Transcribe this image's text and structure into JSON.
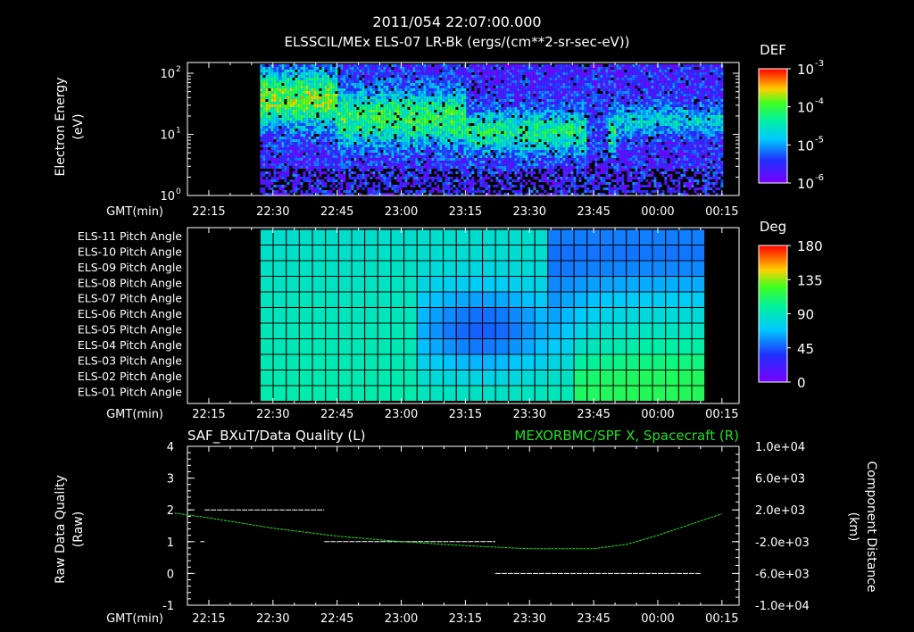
{
  "header": {
    "timestamp": "2011/054 22:07:00.000",
    "subtitle": "ELSSCIL/MEx ELS-07 LR-Bk  (ergs/(cm**2-sr-sec-eV))"
  },
  "time_axis": {
    "label": "GMT(min)",
    "ticks": [
      "22:15",
      "22:30",
      "22:45",
      "23:00",
      "23:15",
      "23:30",
      "23:45",
      "00:00",
      "00:15"
    ],
    "start_minutes": 1330,
    "end_minutes": 1459
  },
  "colors": {
    "background": "#000000",
    "foreground": "#ffffff",
    "series_green": "#22dd22",
    "colorbar_top": "#ff0000",
    "colorbar_bottom": "#6600ff"
  },
  "chart_data": [
    {
      "type": "heatmap",
      "ylabel": "Electron Energy\n(eV)",
      "ylabel_lines": [
        "Electron Energy",
        "(eV)"
      ],
      "yscale": "log",
      "ylim": [
        1,
        150
      ],
      "yticks": [
        {
          "base": "10",
          "exp": "0"
        },
        {
          "base": "10",
          "exp": "1"
        },
        {
          "base": "10",
          "exp": "2"
        }
      ],
      "colorbar": {
        "title": "DEF",
        "scale": "log",
        "range": [
          1e-06,
          0.001
        ],
        "ticks": [
          {
            "base": "10",
            "exp": "-3"
          },
          {
            "base": "10",
            "exp": "-4"
          },
          {
            "base": "10",
            "exp": "-5"
          },
          {
            "base": "10",
            "exp": "-6"
          }
        ]
      },
      "data_coverage": {
        "start": "22:27",
        "end": "00:15"
      }
    },
    {
      "type": "heatmap",
      "yticklabels": [
        "ELS-11 Pitch Angle",
        "ELS-10 Pitch Angle",
        "ELS-09 Pitch Angle",
        "ELS-08 Pitch Angle",
        "ELS-07 Pitch Angle",
        "ELS-06 Pitch Angle",
        "ELS-05 Pitch Angle",
        "ELS-04 Pitch Angle",
        "ELS-03 Pitch Angle",
        "ELS-02 Pitch Angle",
        "ELS-01 Pitch Angle"
      ],
      "colorbar": {
        "title": "Deg",
        "range": [
          0,
          180
        ],
        "ticks": [
          "180",
          "135",
          "90",
          "45",
          "0"
        ]
      },
      "data_coverage": {
        "start": "22:27",
        "end": "00:11"
      }
    },
    {
      "type": "line",
      "title_left": "SAF_BXuT/Data Quality (L)",
      "title_right": "MEXORBMC/SPF X, Spacecraft (R)",
      "ylabel_left_lines": [
        "Raw Data Quality",
        "(Raw)"
      ],
      "ylabel_right_lines": [
        "Component Distance",
        "(km)"
      ],
      "ylim_left": [
        -1,
        4
      ],
      "yticks_left": [
        "4",
        "3",
        "2",
        "1",
        "0",
        "-1"
      ],
      "ylim_right": [
        -10000,
        10000
      ],
      "yticks_right": [
        "1.0e+04",
        "6.0e+03",
        "2.0e+03",
        "-2.0e+03",
        "-6.0e+03",
        "-1.0e+04"
      ],
      "series": [
        {
          "axis": "left",
          "segments": [
            {
              "x": [
                "22:13",
                "22:14"
              ],
              "y": 1
            },
            {
              "x": [
                "22:14",
                "22:42"
              ],
              "y": 2
            },
            {
              "x": [
                "22:42",
                "23:22"
              ],
              "y": 1
            },
            {
              "x": [
                "23:22",
                "00:10"
              ],
              "y": 0
            }
          ]
        },
        {
          "axis": "right",
          "x": [
            "22:07",
            "22:15",
            "22:30",
            "22:45",
            "23:00",
            "23:15",
            "23:30",
            "23:45",
            "23:53",
            "00:00",
            "00:15"
          ],
          "y": [
            1600,
            1000,
            -300,
            -1300,
            -2000,
            -2500,
            -2900,
            -2900,
            -2300,
            -1200,
            1500
          ]
        }
      ]
    }
  ]
}
